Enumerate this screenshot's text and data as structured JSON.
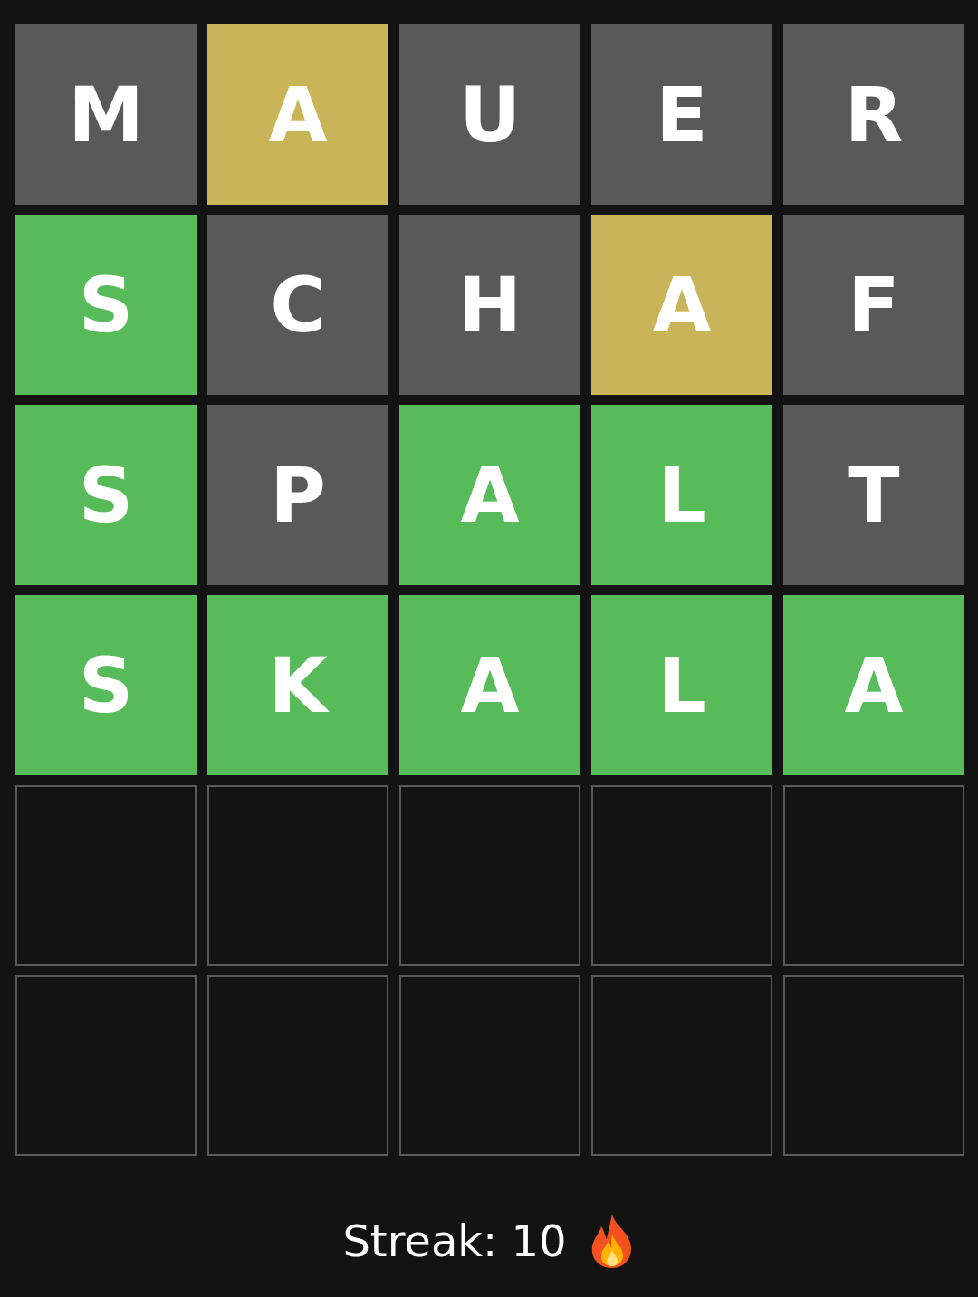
{
  "board": {
    "rows": [
      {
        "tiles": [
          {
            "kind": "letter",
            "letter": "M",
            "color": "#595959"
          },
          {
            "kind": "letter",
            "letter": "A",
            "color": "#c9b458"
          },
          {
            "kind": "letter",
            "letter": "U",
            "color": "#595959"
          },
          {
            "kind": "letter",
            "letter": "E",
            "color": "#595959"
          },
          {
            "kind": "letter",
            "letter": "R",
            "color": "#595959"
          }
        ]
      },
      {
        "tiles": [
          {
            "kind": "letter",
            "letter": "S",
            "color": "#56bb58"
          },
          {
            "kind": "letter",
            "letter": "C",
            "color": "#595959"
          },
          {
            "kind": "letter",
            "letter": "H",
            "color": "#595959"
          },
          {
            "kind": "letter",
            "letter": "A",
            "color": "#c9b458"
          },
          {
            "kind": "letter",
            "letter": "F",
            "color": "#595959"
          }
        ]
      },
      {
        "tiles": [
          {
            "kind": "letter",
            "letter": "S",
            "color": "#56bb58"
          },
          {
            "kind": "letter",
            "letter": "P",
            "color": "#595959"
          },
          {
            "kind": "letter",
            "letter": "A",
            "color": "#56bb58"
          },
          {
            "kind": "letter",
            "letter": "L",
            "color": "#56bb58"
          },
          {
            "kind": "letter",
            "letter": "T",
            "color": "#595959"
          }
        ]
      },
      {
        "tiles": [
          {
            "kind": "letter",
            "letter": "S",
            "color": "#56bb58"
          },
          {
            "kind": "letter",
            "letter": "K",
            "color": "#56bb58"
          },
          {
            "kind": "letter",
            "letter": "A",
            "color": "#56bb58"
          },
          {
            "kind": "letter",
            "letter": "L",
            "color": "#56bb58"
          },
          {
            "kind": "letter",
            "letter": "A",
            "color": "#56bb58"
          }
        ]
      },
      {
        "tiles": [
          {
            "kind": "empty"
          },
          {
            "kind": "empty"
          },
          {
            "kind": "empty"
          },
          {
            "kind": "empty"
          },
          {
            "kind": "empty"
          }
        ]
      },
      {
        "tiles": [
          {
            "kind": "empty"
          },
          {
            "kind": "empty"
          },
          {
            "kind": "empty"
          },
          {
            "kind": "empty"
          },
          {
            "kind": "empty"
          }
        ]
      }
    ]
  },
  "streak": {
    "label": "Streak: 10"
  }
}
